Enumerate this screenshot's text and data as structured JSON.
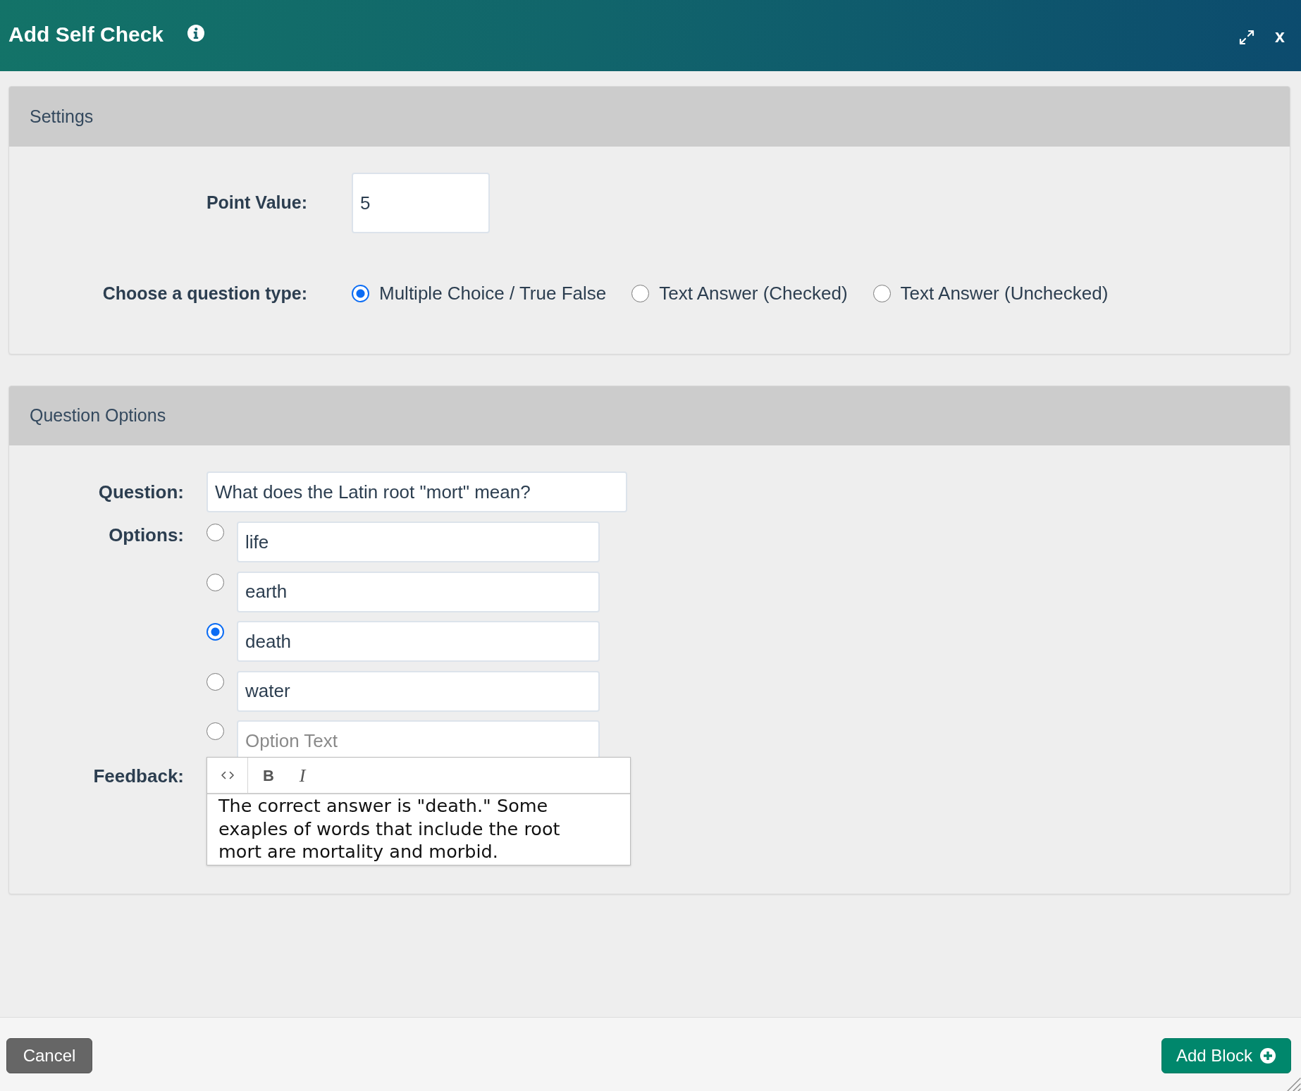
{
  "dialog": {
    "title": "Add Self Check",
    "close_label": "x"
  },
  "settings": {
    "heading": "Settings",
    "point_value": {
      "label": "Point Value:",
      "value": "5"
    },
    "question_type": {
      "label": "Choose a question type:",
      "options": [
        {
          "label": "Multiple Choice / True False",
          "selected": true
        },
        {
          "label": "Text Answer (Checked)",
          "selected": false
        },
        {
          "label": "Text Answer (Unchecked)",
          "selected": false
        }
      ]
    }
  },
  "question_options": {
    "heading": "Question Options",
    "question": {
      "label": "Question:",
      "value": "What does the Latin root \"mort\" mean?"
    },
    "options": {
      "label": "Options:",
      "items": [
        {
          "value": "life",
          "selected": false
        },
        {
          "value": "earth",
          "selected": false
        },
        {
          "value": "death",
          "selected": true
        },
        {
          "value": "water",
          "selected": false
        },
        {
          "placeholder": "Option Text",
          "selected": false
        }
      ]
    },
    "feedback": {
      "label": "Feedback:",
      "toolbar": [
        {
          "kind": "code"
        },
        {
          "kind": "bold",
          "label": "B"
        },
        {
          "kind": "italic",
          "label": "I"
        }
      ],
      "text": "The correct answer is \"death.\" Some exaples of words that include the root mort are mortality and morbid."
    }
  },
  "footer": {
    "buttons": [
      {
        "label": "Cancel",
        "kind": "secondary"
      },
      {
        "label": "Add Block",
        "kind": "primary"
      }
    ]
  }
}
